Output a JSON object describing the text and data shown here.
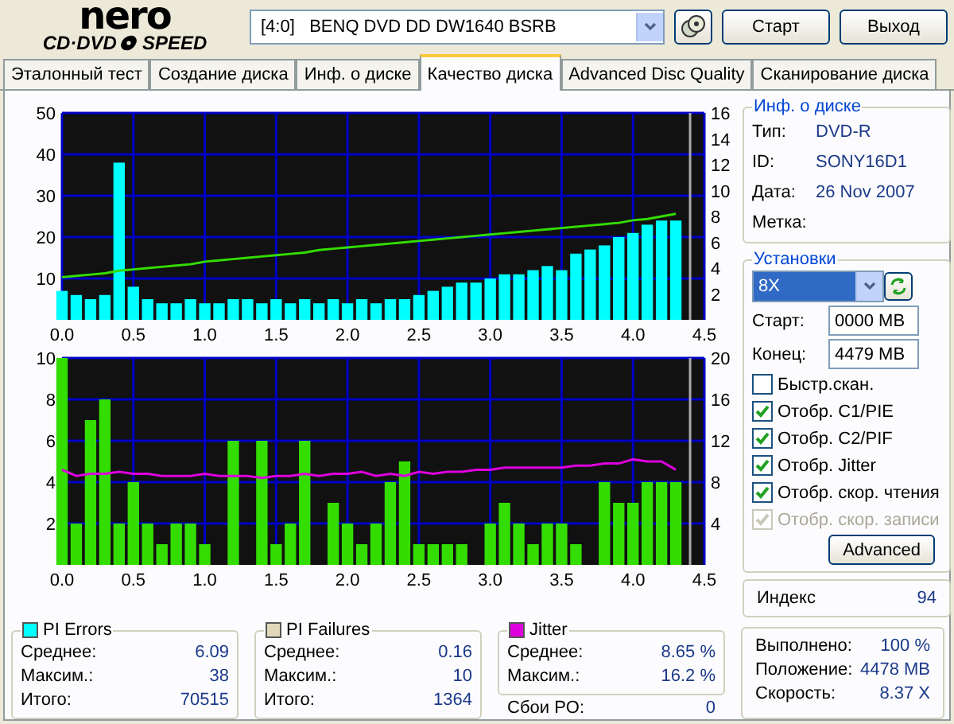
{
  "logo": {
    "top": "nero",
    "left": "CD·DVD",
    "right": "SPEED"
  },
  "drive": {
    "value": "[4:0]   BENQ DVD DD DW1640 BSRB"
  },
  "buttons": [
    {
      "label": "Старт"
    },
    {
      "label": "Выход"
    }
  ],
  "tabs": [
    {
      "label": "Эталонный тест",
      "selected": false
    },
    {
      "label": "Создание диска",
      "selected": false
    },
    {
      "label": "Инф. о диске",
      "selected": false
    },
    {
      "label": "Качество диска",
      "selected": true
    },
    {
      "label": "Advanced Disc Quality",
      "selected": false
    },
    {
      "label": "Сканирование диска",
      "selected": false
    }
  ],
  "charts": [
    {
      "chart_data": {
        "type": "bar",
        "grid": true,
        "ref_lines": [
          {
            "axis": "x",
            "value": 4.4,
            "color": "#aaaaaa"
          }
        ],
        "xlim": [
          0,
          4.5
        ],
        "ylim": [
          0,
          50
        ],
        "y2lim": [
          0,
          16
        ],
        "xticks": [
          {
            "value": 0,
            "label": "0.0"
          },
          {
            "value": 0.5,
            "label": "0.5"
          },
          {
            "value": 1,
            "label": "1.0"
          },
          {
            "value": 1.5,
            "label": "1.5"
          },
          {
            "value": 2,
            "label": "2.0"
          },
          {
            "value": 2.5,
            "label": "2.5"
          },
          {
            "value": 3,
            "label": "3.0"
          },
          {
            "value": 3.5,
            "label": "3.5"
          },
          {
            "value": 4,
            "label": "4.0"
          },
          {
            "value": 4.5,
            "label": "4.5"
          }
        ],
        "yticks": [
          10,
          20,
          30,
          40,
          50
        ],
        "y2ticks": [
          2,
          4,
          6,
          8,
          10,
          12,
          14,
          16
        ],
        "x": [
          0,
          0.1,
          0.2,
          0.3,
          0.4,
          0.5,
          0.6,
          0.7,
          0.8,
          0.9,
          1,
          1.1,
          1.2,
          1.3,
          1.4,
          1.5,
          1.6,
          1.7,
          1.8,
          1.9,
          2,
          2.1,
          2.2,
          2.3,
          2.4,
          2.5,
          2.6,
          2.7,
          2.8,
          2.9,
          3,
          3.1,
          3.2,
          3.3,
          3.4,
          3.5,
          3.6,
          3.7,
          3.8,
          3.9,
          4,
          4.1,
          4.2,
          4.3
        ],
        "series": [
          {
            "color": "#00ffff",
            "values": [
              7,
              6,
              5,
              6,
              38,
              8,
              5,
              4,
              4,
              5,
              4,
              4,
              5,
              5,
              4,
              5,
              4,
              5,
              4,
              5,
              4,
              5,
              4,
              5,
              5,
              6,
              7,
              8,
              9,
              9,
              10,
              11,
              11,
              12,
              13,
              12,
              16,
              17,
              18,
              20,
              21,
              23,
              24,
              24
            ]
          },
          {
            "color": "#33dd00",
            "axis": "y2",
            "type": "line",
            "values": [
              3.3,
              3.4,
              3.5,
              3.6,
              3.8,
              3.9,
              4.0,
              4.1,
              4.2,
              4.3,
              4.5,
              4.6,
              4.7,
              4.8,
              4.9,
              5.0,
              5.1,
              5.2,
              5.4,
              5.5,
              5.6,
              5.7,
              5.8,
              5.9,
              6.0,
              6.1,
              6.2,
              6.3,
              6.4,
              6.5,
              6.6,
              6.7,
              6.8,
              6.9,
              7.0,
              7.1,
              7.2,
              7.3,
              7.4,
              7.5,
              7.7,
              7.8,
              8.0,
              8.2
            ]
          }
        ]
      }
    },
    {
      "chart_data": {
        "type": "bar",
        "grid": true,
        "ref_lines": [
          {
            "axis": "x",
            "value": 4.4,
            "color": "#aaaaaa"
          }
        ],
        "xlim": [
          0,
          4.5
        ],
        "ylim": [
          0,
          10
        ],
        "y2lim": [
          0,
          20
        ],
        "xticks": [
          {
            "value": 0,
            "label": "0.0"
          },
          {
            "value": 0.5,
            "label": "0.5"
          },
          {
            "value": 1,
            "label": "1.0"
          },
          {
            "value": 1.5,
            "label": "1.5"
          },
          {
            "value": 2,
            "label": "2.0"
          },
          {
            "value": 2.5,
            "label": "2.5"
          },
          {
            "value": 3,
            "label": "3.0"
          },
          {
            "value": 3.5,
            "label": "3.5"
          },
          {
            "value": 4,
            "label": "4.0"
          },
          {
            "value": 4.5,
            "label": "4.5"
          }
        ],
        "yticks": [
          2,
          4,
          6,
          8,
          10
        ],
        "y2ticks": [
          4,
          8,
          12,
          16,
          20
        ],
        "x": [
          0,
          0.1,
          0.2,
          0.3,
          0.4,
          0.5,
          0.6,
          0.7,
          0.8,
          0.9,
          1,
          1.1,
          1.2,
          1.3,
          1.4,
          1.5,
          1.6,
          1.7,
          1.8,
          1.9,
          2,
          2.1,
          2.2,
          2.3,
          2.4,
          2.5,
          2.6,
          2.7,
          2.8,
          2.9,
          3,
          3.1,
          3.2,
          3.3,
          3.4,
          3.5,
          3.6,
          3.7,
          3.8,
          3.9,
          4,
          4.1,
          4.2,
          4.3
        ],
        "series": [
          {
            "color": "#33dd00",
            "values": [
              10,
              2,
              7,
              8,
              2,
              4,
              2,
              1,
              2,
              2,
              1,
              0,
              6,
              0,
              6,
              1,
              2,
              6,
              0,
              3,
              2,
              1,
              2,
              4,
              5,
              1,
              1,
              1,
              1,
              0,
              2,
              3,
              2,
              1,
              2,
              2,
              1,
              0,
              4,
              3,
              3,
              4,
              4,
              4
            ]
          },
          {
            "color": "#dd00dd",
            "axis": "y2",
            "type": "line",
            "values": [
              9.2,
              8.6,
              8.8,
              8.8,
              9.0,
              8.8,
              8.8,
              8.6,
              8.6,
              8.6,
              8.8,
              8.6,
              8.6,
              8.6,
              8.4,
              8.6,
              8.6,
              8.8,
              8.6,
              8.8,
              8.8,
              9.0,
              8.6,
              8.8,
              8.6,
              9.0,
              8.8,
              9.0,
              9.0,
              9.2,
              9.2,
              9.4,
              9.4,
              9.4,
              9.4,
              9.4,
              9.6,
              9.6,
              9.8,
              9.8,
              10.2,
              10.0,
              10.0,
              9.2
            ]
          }
        ]
      }
    }
  ],
  "disc_info": {
    "title": "Инф. о диске",
    "rows": [
      {
        "label": "Тип:",
        "value": "DVD-R"
      },
      {
        "label": "ID:",
        "value": "SONY16D1"
      },
      {
        "label": "Дата:",
        "value": "26 Nov 2007"
      },
      {
        "label": "Метка:"
      }
    ]
  },
  "settings": {
    "title": "Установки",
    "speed": "8X",
    "fields": [
      {
        "label": "Старт:",
        "value": "0000 MB"
      },
      {
        "label": "Конец:",
        "value": "4479 MB"
      }
    ],
    "options": [
      {
        "label": "Быстр.скан.",
        "checked": false,
        "disabled": false
      },
      {
        "label": "Отобр. C1/PIE",
        "checked": true,
        "disabled": false
      },
      {
        "label": "Отобр. C2/PIF",
        "checked": true,
        "disabled": false
      },
      {
        "label": "Отобр. Jitter",
        "checked": true,
        "disabled": false
      },
      {
        "label": "Отобр. скор. чтения",
        "checked": true,
        "disabled": false
      },
      {
        "label": "Отобр. скор. записи",
        "checked": true,
        "disabled": true
      }
    ],
    "button": "Advanced"
  },
  "index": {
    "label": "Индекс",
    "value": "94"
  },
  "stats": [
    {
      "title": "PI Errors",
      "color": "#00ffff",
      "rows": [
        {
          "label": "Среднее:",
          "value": "6.09"
        },
        {
          "label": "Максим.:",
          "value": "38"
        },
        {
          "label": "Итого:",
          "value": "70515"
        }
      ]
    },
    {
      "title": "PI Failures",
      "color": "#e0d8b8",
      "rows": [
        {
          "label": "Среднее:",
          "value": "0.16"
        },
        {
          "label": "Максим.:",
          "value": "10"
        },
        {
          "label": "Итого:",
          "value": "1364"
        }
      ]
    },
    {
      "title": "Jitter",
      "color": "#dd00dd",
      "rows": [
        {
          "label": "Среднее:",
          "value": "8.65 %"
        },
        {
          "label": "Максим.:",
          "value": "16.2 %"
        }
      ],
      "extra": {
        "label": "Сбои PO:",
        "value": "0"
      }
    }
  ],
  "progress": [
    {
      "label": "Выполнено:",
      "value": "100 %"
    },
    {
      "label": "Положение:",
      "value": "4478 MB"
    },
    {
      "label": "Скорость:",
      "value": "8.37 X"
    }
  ]
}
